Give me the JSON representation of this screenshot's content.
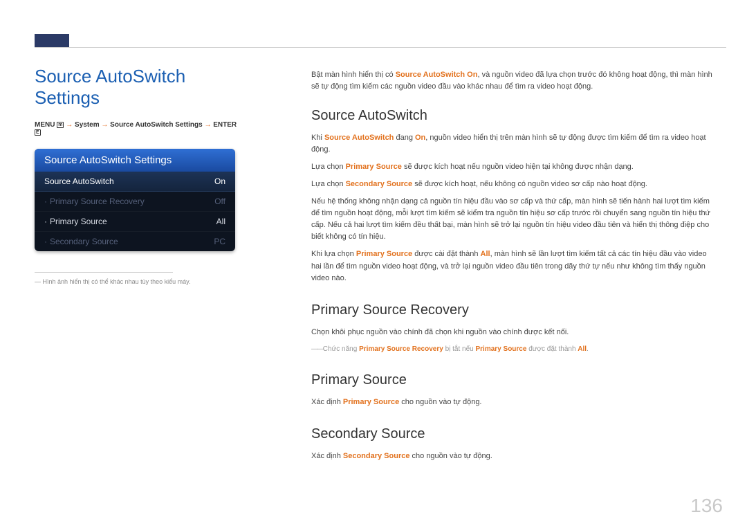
{
  "page_title": "Source AutoSwitch Settings",
  "breadcrumb": {
    "menu": "MENU",
    "menu_icon": "m",
    "arrow": "→",
    "seg1": "System",
    "seg2": "Source AutoSwitch Settings",
    "enter": "ENTER",
    "enter_icon": "E"
  },
  "menu": {
    "header": "Source AutoSwitch Settings",
    "rows": [
      {
        "label": "Source AutoSwitch",
        "value": "On",
        "state": "selected"
      },
      {
        "label": "Primary Source Recovery",
        "value": "Off",
        "state": "disabled"
      },
      {
        "label": "Primary Source",
        "value": "All",
        "state": "normal"
      },
      {
        "label": "Secondary Source",
        "value": "PC",
        "state": "disabled"
      }
    ]
  },
  "caption": "Hình ảnh hiển thị có thể khác nhau tùy theo kiểu máy.",
  "intro": {
    "p1a": "Bật màn hình hiển thị có ",
    "hl1": "Source AutoSwitch On",
    "p1b": ", và nguồn video đã lựa chọn trước đó không hoạt động, thì màn hình sẽ tự động tìm kiếm các nguồn video đầu vào khác nhau để tìm ra video hoạt động."
  },
  "sec1": {
    "title": "Source AutoSwitch",
    "p1a": "Khi ",
    "hl1": "Source AutoSwitch",
    "p1b": " đang ",
    "hl2": "On",
    "p1c": ", nguồn video hiển thị trên màn hình sẽ tự động được tìm kiếm để tìm ra video hoạt động.",
    "p2a": "Lựa chọn ",
    "hl3": "Primary Source",
    "p2b": " sẽ được kích hoạt nếu nguồn video hiện tại không được nhận dạng.",
    "p3a": "Lựa chọn ",
    "hl4": "Secondary Source",
    "p3b": " sẽ được kích hoạt, nếu không có nguồn video sơ cấp nào hoạt động.",
    "p4": "Nếu hệ thống không nhận dạng cả nguồn tín hiệu đầu vào sơ cấp và thứ cấp, màn hình sẽ tiến hành hai lượt tìm kiếm để tìm nguồn hoạt động, mỗi lượt tìm kiếm sẽ kiểm tra nguồn tín hiệu sơ cấp trước rồi chuyển sang nguồn tín hiệu thứ cấp. Nếu cả hai lượt tìm kiếm đều thất bại, màn hình sẽ trở lại nguồn tín hiệu video đầu tiên và hiển thị thông điệp cho biết không có tín hiệu.",
    "p5a": "Khi lựa chọn ",
    "hl5": "Primary Source",
    "p5b": " được cài đặt thành ",
    "hl6": "All",
    "p5c": ", màn hình sẽ lần lượt tìm kiếm tất cả các tín hiệu đầu vào video hai lần để tìm nguồn video hoạt động, và trở lại nguồn video đầu tiên trong dãy thứ tự nếu như không tìm thấy nguồn video nào."
  },
  "sec2": {
    "title": "Primary Source Recovery",
    "p1": "Chọn khôi phục nguồn vào chính đã chọn khi nguồn vào chính được kết nối.",
    "note_a": "Chức năng ",
    "note_hl1": "Primary Source Recovery",
    "note_b": " bị tắt nếu ",
    "note_hl2": "Primary Source",
    "note_c": " được đặt thành ",
    "note_hl3": "All",
    "note_d": "."
  },
  "sec3": {
    "title": "Primary Source",
    "p1a": "Xác định ",
    "hl1": "Primary Source",
    "p1b": " cho nguồn vào tự động."
  },
  "sec4": {
    "title": "Secondary Source",
    "p1a": "Xác định ",
    "hl1": "Secondary Source",
    "p1b": " cho nguồn vào tự động."
  },
  "page_number": "136"
}
